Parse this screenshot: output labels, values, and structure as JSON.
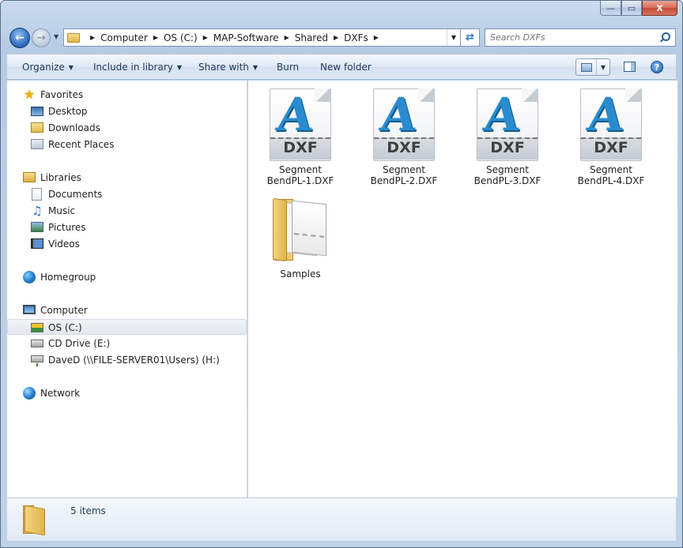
{
  "window": {
    "caption_buttons": {
      "minimize": "—",
      "maximize": "▭",
      "close": "X"
    }
  },
  "address_bar": {
    "breadcrumbs": [
      "Computer",
      "OS (C:)",
      "MAP-Software",
      "Shared",
      "DXFs"
    ]
  },
  "search": {
    "placeholder": "Search DXFs"
  },
  "toolbar": {
    "organize": "Organize",
    "include_in_library": "Include in library",
    "share_with": "Share with",
    "burn": "Burn",
    "new_folder": "New folder",
    "help": "?"
  },
  "nav": {
    "favorites": {
      "label": "Favorites",
      "icon": "star-icon",
      "items": [
        {
          "label": "Desktop",
          "icon": "desktop-icon"
        },
        {
          "label": "Downloads",
          "icon": "downloads-icon"
        },
        {
          "label": "Recent Places",
          "icon": "recent-places-icon"
        }
      ]
    },
    "libraries": {
      "label": "Libraries",
      "icon": "libraries-icon",
      "items": [
        {
          "label": "Documents",
          "icon": "documents-icon"
        },
        {
          "label": "Music",
          "icon": "music-icon"
        },
        {
          "label": "Pictures",
          "icon": "pictures-icon"
        },
        {
          "label": "Videos",
          "icon": "videos-icon"
        }
      ]
    },
    "homegroup": {
      "label": "Homegroup",
      "icon": "homegroup-icon"
    },
    "computer": {
      "label": "Computer",
      "icon": "computer-icon",
      "items": [
        {
          "label": "OS (C:)",
          "icon": "os-drive-icon",
          "selected": true
        },
        {
          "label": "CD Drive (E:)",
          "icon": "cd-drive-icon"
        },
        {
          "label": "DaveD (\\\\FILE-SERVER01\\Users) (H:)",
          "icon": "network-drive-icon"
        }
      ]
    },
    "network": {
      "label": "Network",
      "icon": "network-icon"
    }
  },
  "files": [
    {
      "line1": "Segment",
      "line2": "BendPL-1.DXF",
      "type": "DXF"
    },
    {
      "line1": "Segment",
      "line2": "BendPL-2.DXF",
      "type": "DXF"
    },
    {
      "line1": "Segment",
      "line2": "BendPL-3.DXF",
      "type": "DXF"
    },
    {
      "line1": "Segment",
      "line2": "BendPL-4.DXF",
      "type": "DXF"
    },
    {
      "line1": "Samples",
      "line2": "",
      "type": "folder"
    }
  ],
  "dxf_badge": "DXF",
  "dxf_glyph": "A",
  "details": {
    "count": "5 items"
  },
  "colors": {
    "accent": "#1e395b",
    "dxf_blue": "#2a8ccf",
    "selection": "#e2e8f0"
  }
}
